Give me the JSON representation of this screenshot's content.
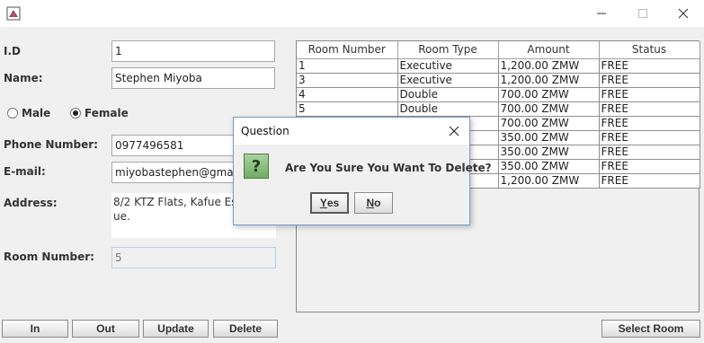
{
  "window": {
    "title": "",
    "minimize_label": "—",
    "maximize_label": "☐",
    "close_label": "✕"
  },
  "form": {
    "id_label": "I.D",
    "id_value": "1",
    "name_label": "Name:",
    "name_value": "Stephen Miyoba",
    "gender": {
      "male_label": "Male",
      "female_label": "Female",
      "selected": "Female"
    },
    "phone_label": "Phone Number:",
    "phone_value": "0977496581",
    "email_label": "E-mail:",
    "email_value": "miyobastephen@gmail.c",
    "address_label": "Address:",
    "address_line1": "8/2 KTZ Flats, Kafue Esta",
    "address_line2": "ue.",
    "room_label": "Room Number:",
    "room_value": "5"
  },
  "buttons": {
    "in": "In",
    "out": "Out",
    "update": "Update",
    "delete": "Delete",
    "select_room": "Select Room"
  },
  "table": {
    "headers": [
      "Room Number",
      "Room Type",
      "Amount",
      "Status"
    ],
    "rows": [
      [
        "1",
        "Executive",
        "1,200.00 ZMW",
        "FREE"
      ],
      [
        "3",
        "Executive",
        "1,200.00 ZMW",
        "FREE"
      ],
      [
        "4",
        "Double",
        "700.00 ZMW",
        "FREE"
      ],
      [
        "5",
        "Double",
        "700.00 ZMW",
        "FREE"
      ],
      [
        "",
        "",
        "700.00 ZMW",
        "FREE"
      ],
      [
        "",
        "",
        "350.00 ZMW",
        "FREE"
      ],
      [
        "",
        "",
        "350.00 ZMW",
        "FREE"
      ],
      [
        "",
        "",
        "350.00 ZMW",
        "FREE"
      ],
      [
        "",
        "",
        "1,200.00 ZMW",
        "FREE"
      ]
    ]
  },
  "dialog": {
    "title": "Question",
    "message": "Are You Sure You Want To Delete?",
    "icon_text": "?",
    "yes_mnemonic": "Y",
    "yes_rest": "es",
    "no_mnemonic": "N",
    "no_rest": "o"
  },
  "colors": {
    "accent": "#7a9cc6",
    "question_icon": "#6fae62"
  }
}
